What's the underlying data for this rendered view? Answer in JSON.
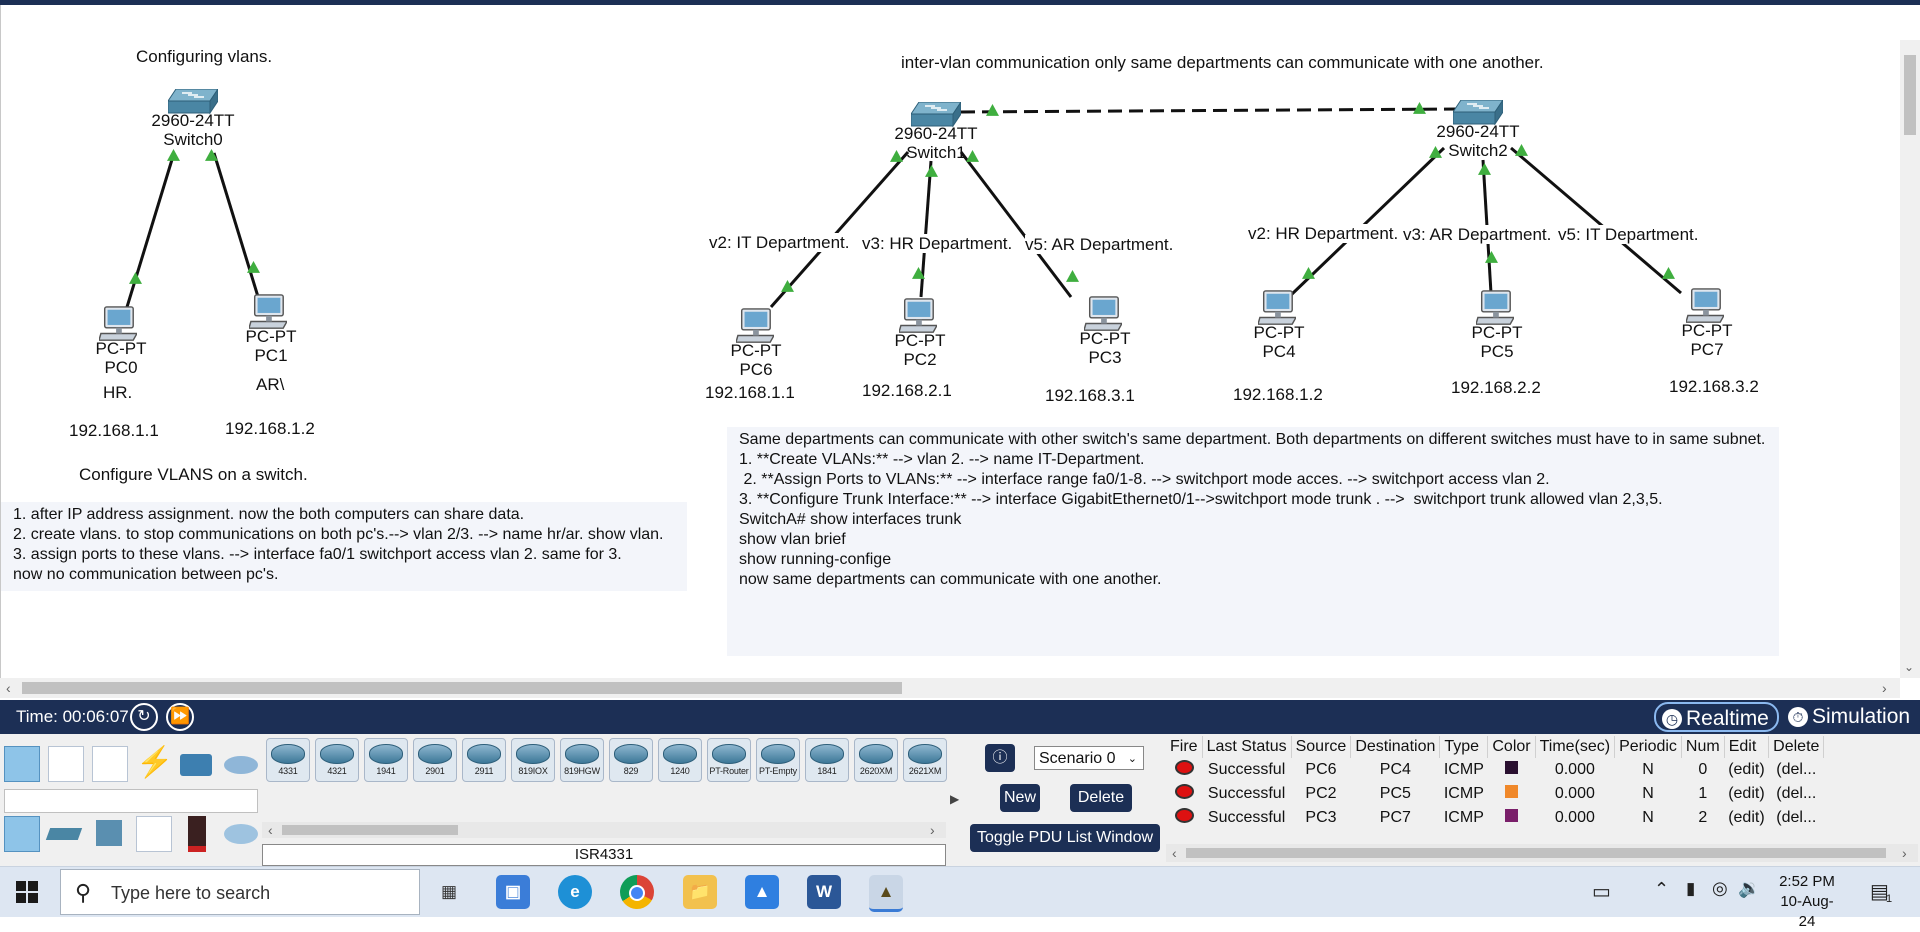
{
  "workspace": {
    "left_title": "Configuring vlans.",
    "right_title": "inter-vlan communication only same departments can communicate with one another.",
    "switches": [
      {
        "model": "2960-24TT",
        "name": "Switch0"
      },
      {
        "model": "2960-24TT",
        "name": "Switch1"
      },
      {
        "model": "2960-24TT",
        "name": "Switch2"
      }
    ],
    "pcs": [
      {
        "type": "PC-PT",
        "name": "PC0",
        "ip": "192.168.1.1",
        "note": "HR."
      },
      {
        "type": "PC-PT",
        "name": "PC1",
        "ip": "192.168.1.2",
        "note": "AR\\"
      },
      {
        "type": "PC-PT",
        "name": "PC6",
        "ip": "192.168.1.1"
      },
      {
        "type": "PC-PT",
        "name": "PC2",
        "ip": "192.168.2.1"
      },
      {
        "type": "PC-PT",
        "name": "PC3",
        "ip": "192.168.3.1"
      },
      {
        "type": "PC-PT",
        "name": "PC4",
        "ip": "192.168.1.2"
      },
      {
        "type": "PC-PT",
        "name": "PC5",
        "ip": "192.168.2.2"
      },
      {
        "type": "PC-PT",
        "name": "PC7",
        "ip": "192.168.3.2"
      }
    ],
    "vlan_labels": [
      "v2: IT Department.",
      "v3: HR Department.",
      "v5: AR Department.",
      "v2: HR Department.",
      "v3: AR Department.",
      "v5: IT Department."
    ],
    "left_subtitle": "Configure VLANS on a switch.",
    "left_note": [
      "1. after IP address assignment. now the both computers can share data.",
      "2. create vlans. to stop communications on both pc's.--> vlan 2/3. --> name hr/ar. show vlan.",
      "3. assign ports to these vlans. --> interface fa0/1 switchport access vlan 2. same for 3.",
      "now no communication between pc's."
    ],
    "right_note": [
      "Same departments can communicate with other switch's same department. Both departments on different switches must have to in same subnet.",
      "1. **Create VLANs:** --> vlan 2. --> name IT-Department.",
      " 2. **Assign Ports to VLANs:** --> interface range fa0/1-8. --> switchport mode acces. --> switchport access vlan 2.",
      "3. **Configure Trunk Interface:** --> interface GigabitEthernet0/1-->switchport mode trunk . -->  switchport trunk allowed vlan 2,3,5.",
      "SwitchA# show interfaces trunk",
      "show vlan brief",
      "show running-confige",
      "now same departments can communicate with one another."
    ]
  },
  "timebar": {
    "time_label": "Time: 00:06:07",
    "realtime_label": "Realtime",
    "simulation_label": "Simulation"
  },
  "devices": {
    "models": [
      "4331",
      "4321",
      "1941",
      "2901",
      "2911",
      "819IOX",
      "819HGW",
      "829",
      "1240",
      "PT-Router",
      "PT-Empty",
      "1841",
      "2620XM",
      "2621XM"
    ],
    "selected_label": "ISR4331"
  },
  "pdu": {
    "scenario": "Scenario 0",
    "new_label": "New",
    "delete_label": "Delete",
    "toggle_label": "Toggle PDU List Window",
    "headers": [
      "Fire",
      "Last Status",
      "Source",
      "Destination",
      "Type",
      "Color",
      "Time(sec)",
      "Periodic",
      "Num",
      "Edit",
      "Delete"
    ],
    "rows": [
      {
        "status": "Successful",
        "source": "PC6",
        "destination": "PC4",
        "type": "ICMP",
        "color": "#2a1030",
        "time": "0.000",
        "periodic": "N",
        "num": "0",
        "edit": "(edit)",
        "delete": "(del..."
      },
      {
        "status": "Successful",
        "source": "PC2",
        "destination": "PC5",
        "type": "ICMP",
        "color": "#f0882a",
        "time": "0.000",
        "periodic": "N",
        "num": "1",
        "edit": "(edit)",
        "delete": "(del..."
      },
      {
        "status": "Successful",
        "source": "PC3",
        "destination": "PC7",
        "type": "ICMP",
        "color": "#7a1f6a",
        "time": "0.000",
        "periodic": "N",
        "num": "2",
        "edit": "(edit)",
        "delete": "(del..."
      }
    ]
  },
  "taskbar": {
    "search_placeholder": "Type here to search",
    "clock_time": "2:52 PM",
    "clock_date": "10-Aug-24",
    "notification_count": "1"
  }
}
